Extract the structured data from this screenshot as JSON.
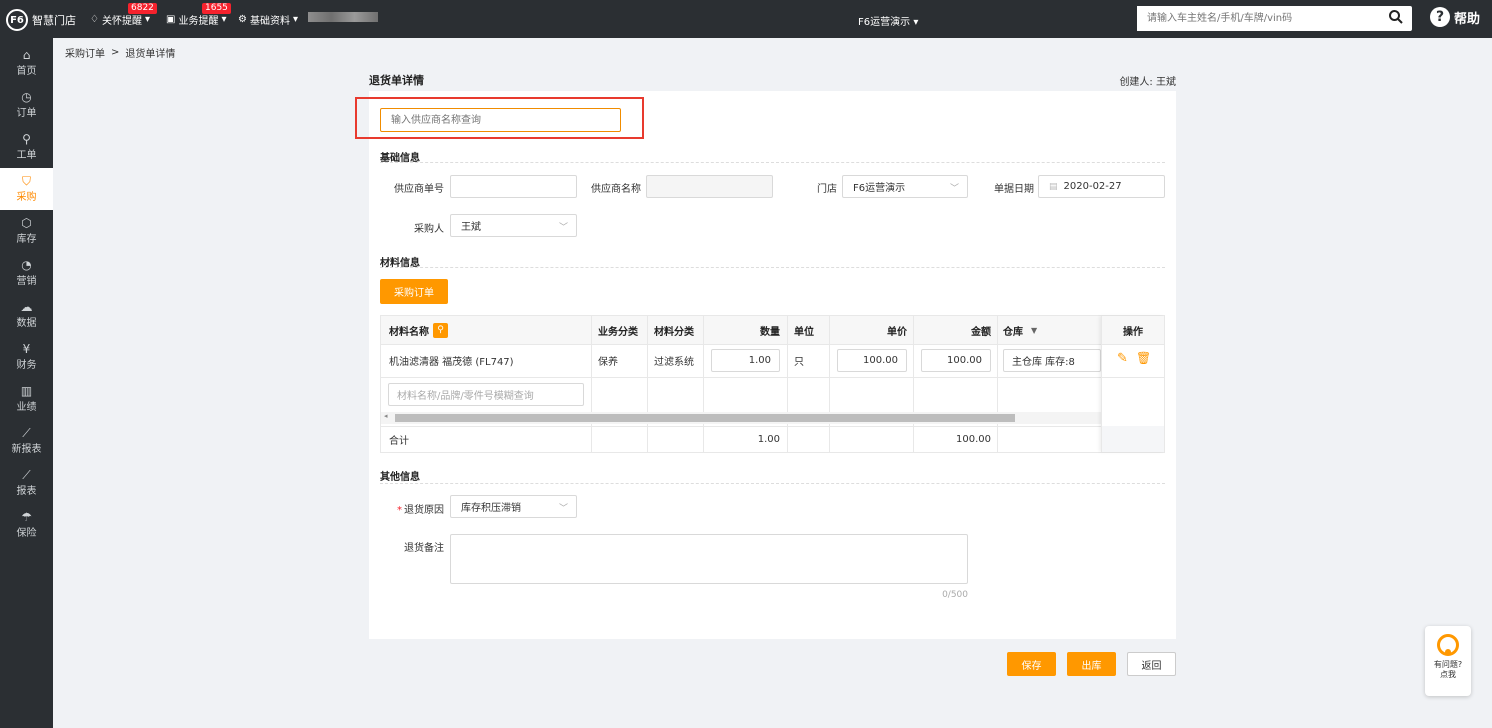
{
  "topbar": {
    "logo_text": "智慧门店",
    "logo_mark": "F6",
    "care_reminder": "关怀提醒",
    "care_badge": "6822",
    "biz_reminder": "业务提醒",
    "biz_badge": "1655",
    "base_data": "基础资料",
    "store": "F6运营演示",
    "search_placeholder": "请输入车主姓名/手机/车牌/vin码",
    "help": "帮助"
  },
  "sidebar": [
    {
      "label": "首页",
      "icon": "home-icon"
    },
    {
      "label": "订单",
      "icon": "clock-icon"
    },
    {
      "label": "工单",
      "icon": "wrench-icon"
    },
    {
      "label": "采购",
      "icon": "cart-icon"
    },
    {
      "label": "库存",
      "icon": "box-icon"
    },
    {
      "label": "营销",
      "icon": "pie-icon"
    },
    {
      "label": "数据",
      "icon": "cloud-icon"
    },
    {
      "label": "财务",
      "icon": "yen-icon"
    },
    {
      "label": "业绩",
      "icon": "bar-chart-icon"
    },
    {
      "label": "新报表",
      "icon": "line-chart-icon"
    },
    {
      "label": "报表",
      "icon": "line-chart-icon"
    },
    {
      "label": "保险",
      "icon": "umbrella-icon"
    }
  ],
  "breadcrumb": {
    "parent": "采购订单",
    "sep": ">",
    "current": "退货单详情"
  },
  "page": {
    "title": "退货单详情",
    "creator": "创建人: 王斌",
    "supplier_search_placeholder": "输入供应商名称查询"
  },
  "basic": {
    "heading": "基础信息",
    "supplier_no_label": "供应商单号",
    "supplier_no_value": "",
    "supplier_name_label": "供应商名称",
    "supplier_name_value": "",
    "store_label": "门店",
    "store_value": "F6运营演示",
    "date_label": "单据日期",
    "date_value": "2020-02-27",
    "buyer_label": "采购人",
    "buyer_value": "王斌"
  },
  "material": {
    "heading": "材料信息",
    "po_button": "采购订单",
    "columns": {
      "name": "材料名称",
      "biz_type": "业务分类",
      "mat_type": "材料分类",
      "qty": "数量",
      "unit": "单位",
      "price": "单价",
      "amount": "金额",
      "warehouse": "仓库",
      "op": "操作"
    },
    "rows": [
      {
        "name": "机油滤清器 福茂德 (FL747)",
        "biz_type": "保养",
        "mat_type": "过滤系统",
        "qty": "1.00",
        "unit": "只",
        "price": "100.00",
        "amount": "100.00",
        "warehouse": "主仓库 库存:8"
      }
    ],
    "search_placeholder": "材料名称/品牌/零件号模糊查询",
    "total_label": "合计",
    "total_qty": "1.00",
    "total_amount": "100.00"
  },
  "other": {
    "heading": "其他信息",
    "reason_label": "退货原因",
    "reason_value": "库存积压滞销",
    "note_label": "退货备注",
    "note_value": "",
    "counter": "0/500"
  },
  "actions": {
    "save": "保存",
    "out": "出库",
    "back": "返回"
  },
  "help_float": {
    "line1": "有问题?",
    "line2": "点我"
  },
  "colors": {
    "accent": "#ff9800",
    "topbar": "#2b2f33",
    "highlight": "#e83a2e"
  }
}
